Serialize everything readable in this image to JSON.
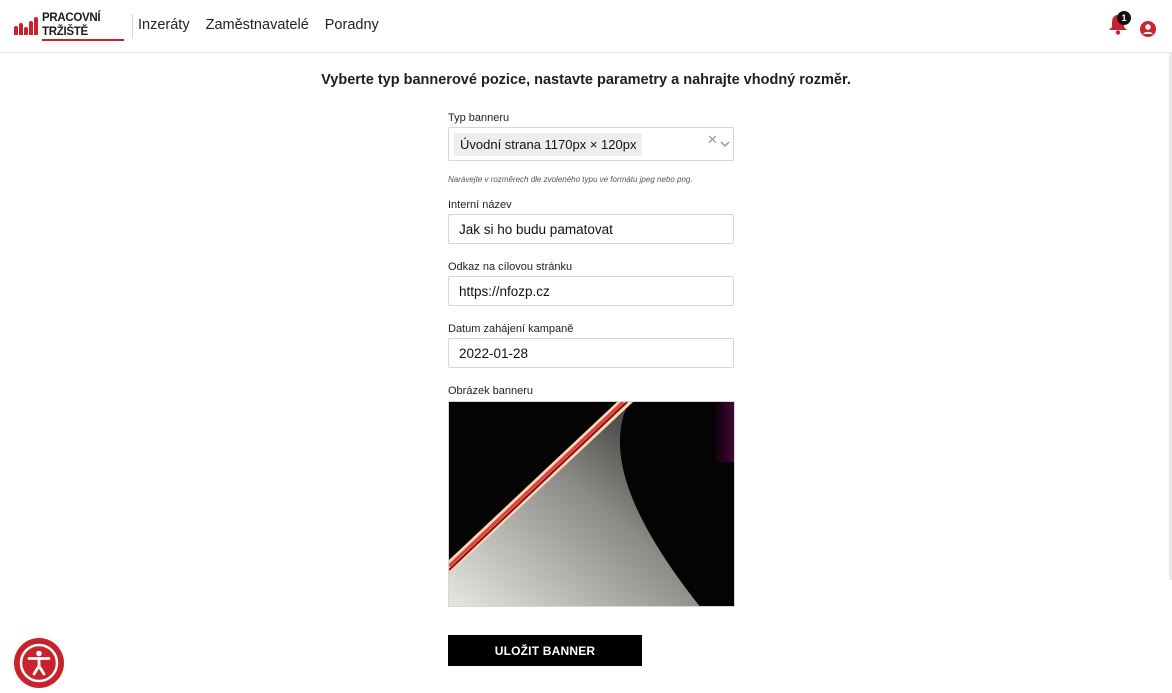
{
  "header": {
    "logo_text": "PRACOVNÍ TRŽIŠTĚ",
    "nav": [
      "Inzeráty",
      "Zaměstnavatelé",
      "Poradny"
    ],
    "notification_count": "1"
  },
  "form": {
    "heading": "Vyberte typ bannerové pozice, nastavte parametry a nahrajte vhodný rozměr.",
    "banner_type": {
      "label": "Typ banneru",
      "value": "Úvodní strana 1170px × 120px"
    },
    "hint": "Narávejte v rozměrech dle zvoleného typu ve formátu jpeg nebo png.",
    "internal_name": {
      "label": "Interní název",
      "value": "Jak si ho budu pamatovat"
    },
    "target_link": {
      "label": "Odkaz na cílovou stránku",
      "value": "https://nfozp.cz"
    },
    "start_date": {
      "label": "Datum zahájení kampaně",
      "value": "2022-01-28"
    },
    "image": {
      "label": "Obrázek banneru"
    },
    "save_label": "ULOŽIT BANNER"
  },
  "colors": {
    "brand_red": "#c8232c",
    "button_black": "#000000"
  },
  "icons": [
    "bell-icon",
    "user-icon",
    "clear-icon",
    "chevron-down-icon",
    "accessibility-icon"
  ]
}
